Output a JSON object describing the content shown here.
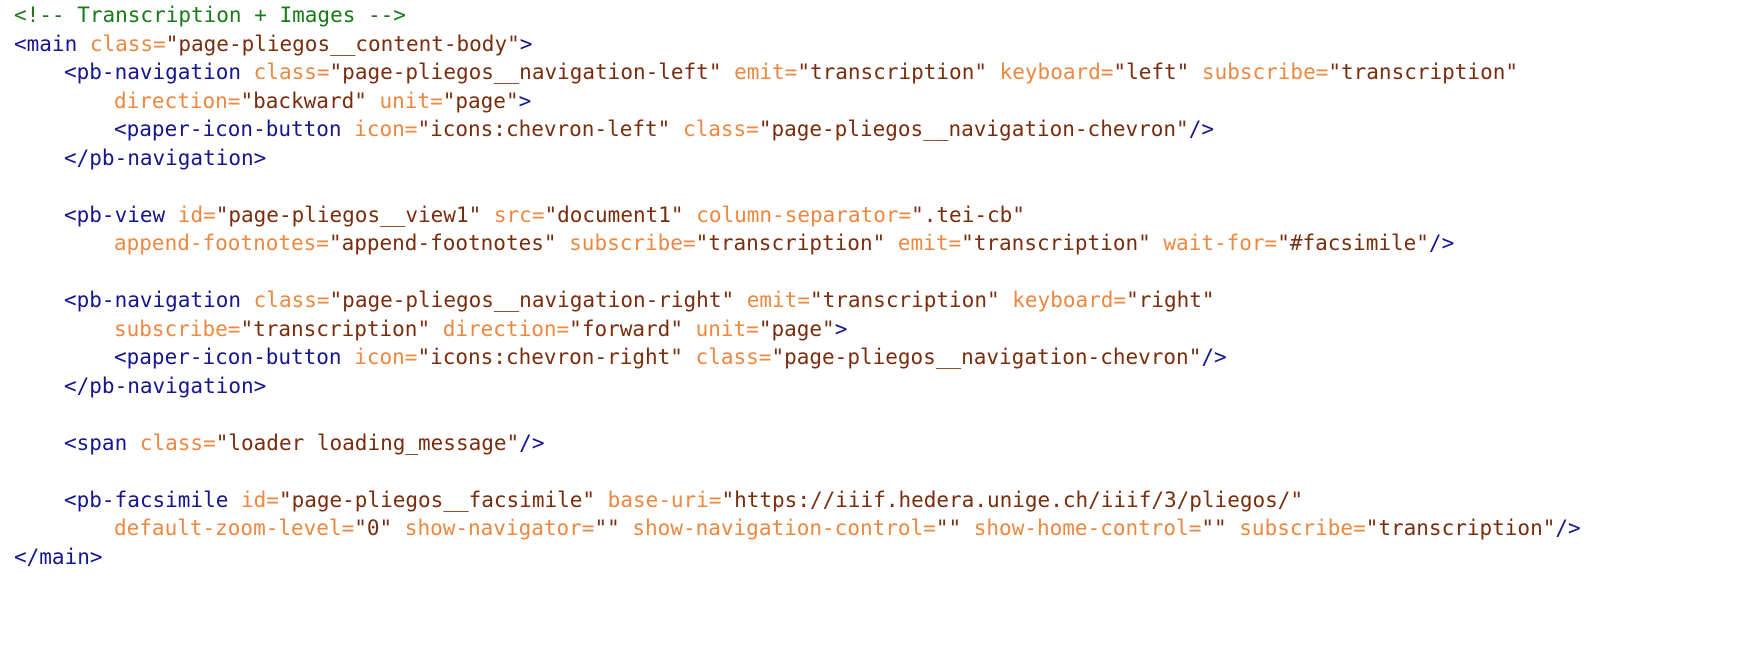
{
  "code": {
    "comment": "<!-- Transcription + Images -->",
    "main_open": "<main",
    "main_class_attr": " class=",
    "main_class_val": "\"page-pliegos__content-body\"",
    "main_open_end": ">",
    "nav1_tag": "<pb-navigation",
    "nav1_a1": " class=",
    "nav1_v1": "\"page-pliegos__navigation-left\"",
    "nav1_a2": " emit=",
    "nav1_v2": "\"transcription\"",
    "nav1_a3": " keyboard=",
    "nav1_v3": "\"left\"",
    "nav1_a4": " subscribe=",
    "nav1_v4": "\"transcription\"",
    "nav1_a5": "direction=",
    "nav1_v5": "\"backward\"",
    "nav1_a6": " unit=",
    "nav1_v6": "\"page\"",
    "nav1_end": ">",
    "icon1_tag": "<paper-icon-button",
    "icon1_a1": " icon=",
    "icon1_v1": "\"icons:chevron-left\"",
    "icon1_a2": " class=",
    "icon1_v2": "\"page-pliegos__navigation-chevron\"",
    "icon1_end": "/>",
    "nav1_close": "</pb-navigation>",
    "view_tag": "<pb-view",
    "view_a1": " id=",
    "view_v1": "\"page-pliegos__view1\"",
    "view_a2": " src=",
    "view_v2": "\"document1\"",
    "view_a3": " column-separator=",
    "view_v3": "\".tei-cb\"",
    "view_a4": "append-footnotes=",
    "view_v4": "\"append-footnotes\"",
    "view_a5": " subscribe=",
    "view_v5": "\"transcription\"",
    "view_a6": " emit=",
    "view_v6": "\"transcription\"",
    "view_a7": " wait-for=",
    "view_v7": "\"#facsimile\"",
    "view_end": "/>",
    "nav2_tag": "<pb-navigation",
    "nav2_a1": " class=",
    "nav2_v1": "\"page-pliegos__navigation-right\"",
    "nav2_a2": " emit=",
    "nav2_v2": "\"transcription\"",
    "nav2_a3": " keyboard=",
    "nav2_v3": "\"right\"",
    "nav2_a4": "subscribe=",
    "nav2_v4": "\"transcription\"",
    "nav2_a5": " direction=",
    "nav2_v5": "\"forward\"",
    "nav2_a6": " unit=",
    "nav2_v6": "\"page\"",
    "nav2_end": ">",
    "icon2_tag": "<paper-icon-button",
    "icon2_a1": " icon=",
    "icon2_v1": "\"icons:chevron-right\"",
    "icon2_a2": " class=",
    "icon2_v2": "\"page-pliegos__navigation-chevron\"",
    "icon2_end": "/>",
    "nav2_close": "</pb-navigation>",
    "span_tag": "<span",
    "span_a1": " class=",
    "span_v1": "\"loader loading_message\"",
    "span_end": "/>",
    "fac_tag": "<pb-facsimile",
    "fac_a1": " id=",
    "fac_v1": "\"page-pliegos__facsimile\"",
    "fac_a2": " base-uri=",
    "fac_v2": "\"https://iiif.hedera.unige.ch/iiif/3/pliegos/\"",
    "fac_a3": "default-zoom-level=",
    "fac_v3": "\"0\"",
    "fac_a4": " show-navigator=",
    "fac_v4": "\"\"",
    "fac_a5": " show-navigation-control=",
    "fac_v5": "\"\"",
    "fac_a6": " show-home-control=",
    "fac_v6": "\"\"",
    "fac_a7": " subscribe=",
    "fac_v7": "\"transcription\"",
    "fac_end": "/>",
    "main_close": "</main>"
  }
}
